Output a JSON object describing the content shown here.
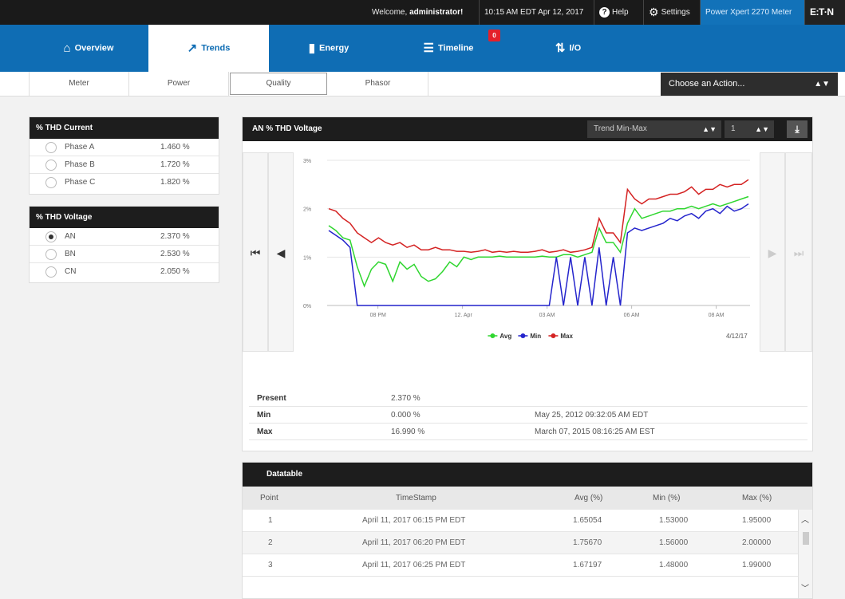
{
  "topbar": {
    "welcome_prefix": "Welcome,",
    "user": "administrator!",
    "datetime": "10:15 AM EDT Apr 12, 2017",
    "help": "Help",
    "settings": "Settings",
    "meter_name": "Power Xpert 2270 Meter",
    "brand": "E:T·N"
  },
  "nav": {
    "tabs": [
      {
        "label": "Overview",
        "icon": "home-icon"
      },
      {
        "label": "Trends",
        "icon": "trend-icon"
      },
      {
        "label": "Energy",
        "icon": "bar-chart-icon"
      },
      {
        "label": "Timeline",
        "icon": "list-icon",
        "badge": "0"
      },
      {
        "label": "I/O",
        "icon": "sort-arrows-icon"
      }
    ],
    "active": "Trends"
  },
  "subnav": {
    "tabs": [
      "Meter",
      "Power",
      "Quality",
      "Phasor"
    ],
    "active": "Quality",
    "action_label": "Choose an Action..."
  },
  "thd_current": {
    "title": "% THD Current",
    "rows": [
      {
        "label": "Phase A",
        "value": "1.460 %",
        "selected": false
      },
      {
        "label": "Phase B",
        "value": "1.720 %",
        "selected": false
      },
      {
        "label": "Phase C",
        "value": "1.820 %",
        "selected": false
      }
    ]
  },
  "thd_voltage": {
    "title": "% THD Voltage",
    "rows": [
      {
        "label": "AN",
        "value": "2.370 %",
        "selected": true
      },
      {
        "label": "BN",
        "value": "2.530 %",
        "selected": false
      },
      {
        "label": "CN",
        "value": "2.050 %",
        "selected": false
      }
    ]
  },
  "chart_panel": {
    "title": "AN % THD Voltage",
    "trend_select": "Trend Min-Max",
    "interval_select": "1",
    "date_label": "4/12/17"
  },
  "chart_data": {
    "type": "line",
    "title": "",
    "xlabel": "",
    "ylabel": "",
    "xtick_labels": [
      "08 PM",
      "12. Apr",
      "03 AM",
      "06 AM",
      "08 AM"
    ],
    "ytick_labels": [
      "0%",
      "1%",
      "2%",
      "3%"
    ],
    "ylim": [
      0,
      3
    ],
    "legend_position": "bottom",
    "series": [
      {
        "name": "Avg",
        "color": "#2fd62f",
        "values": [
          1.65,
          1.55,
          1.4,
          1.35,
          0.8,
          0.4,
          0.75,
          0.9,
          0.85,
          0.5,
          0.9,
          0.75,
          0.85,
          0.6,
          0.5,
          0.55,
          0.7,
          0.9,
          0.8,
          1.0,
          0.95,
          1.0,
          1.0,
          1.0,
          1.02,
          1.0,
          1.0,
          1.0,
          1.0,
          1.0,
          1.02,
          1.0,
          1.0,
          1.05,
          1.05,
          1.0,
          1.05,
          1.1,
          1.6,
          1.3,
          1.3,
          1.1,
          1.7,
          2.0,
          1.8,
          1.85,
          1.9,
          1.95,
          1.95,
          2.0,
          2.0,
          2.05,
          2.0,
          2.05,
          2.1,
          2.05,
          2.1,
          2.15,
          2.2,
          2.25
        ]
      },
      {
        "name": "Min",
        "color": "#2424cc",
        "values": [
          1.55,
          1.45,
          1.35,
          1.2,
          0.0,
          0.0,
          0.0,
          0.0,
          0.0,
          0.0,
          0.0,
          0.0,
          0.0,
          0.0,
          0.0,
          0.0,
          0.0,
          0.0,
          0.0,
          0.0,
          0.0,
          0.0,
          0.0,
          0.0,
          0.0,
          0.0,
          0.0,
          0.0,
          0.0,
          0.0,
          0.0,
          0.0,
          1.0,
          0.0,
          1.0,
          0.0,
          1.0,
          0.0,
          1.2,
          0.0,
          1.0,
          0.0,
          1.5,
          1.6,
          1.55,
          1.6,
          1.65,
          1.7,
          1.8,
          1.75,
          1.85,
          1.9,
          1.8,
          1.95,
          2.0,
          1.9,
          2.05,
          1.95,
          2.0,
          2.1
        ]
      },
      {
        "name": "Max",
        "color": "#d42222",
        "values": [
          2.0,
          1.95,
          1.8,
          1.7,
          1.5,
          1.4,
          1.3,
          1.4,
          1.3,
          1.25,
          1.3,
          1.2,
          1.25,
          1.15,
          1.15,
          1.2,
          1.15,
          1.15,
          1.12,
          1.12,
          1.1,
          1.12,
          1.15,
          1.1,
          1.12,
          1.1,
          1.12,
          1.1,
          1.1,
          1.12,
          1.15,
          1.1,
          1.12,
          1.15,
          1.1,
          1.12,
          1.15,
          1.2,
          1.8,
          1.5,
          1.5,
          1.3,
          2.4,
          2.2,
          2.1,
          2.2,
          2.2,
          2.25,
          2.3,
          2.3,
          2.35,
          2.45,
          2.3,
          2.4,
          2.4,
          2.5,
          2.45,
          2.5,
          2.5,
          2.6
        ]
      }
    ]
  },
  "stats": [
    {
      "label": "Present",
      "value": "2.370 %",
      "time": ""
    },
    {
      "label": "Min",
      "value": "0.000 %",
      "time": "May 25, 2012 09:32:05 AM EDT"
    },
    {
      "label": "Max",
      "value": "16.990 %",
      "time": "March 07, 2015 08:16:25 AM EST"
    }
  ],
  "datatable": {
    "title": "Datatable",
    "columns": [
      "Point",
      "TimeStamp",
      "Avg (%)",
      "Min (%)",
      "Max (%)"
    ],
    "rows": [
      [
        "1",
        "April 11, 2017 06:15 PM EDT",
        "1.65054",
        "1.53000",
        "1.95000"
      ],
      [
        "2",
        "April 11, 2017 06:20 PM EDT",
        "1.75670",
        "1.56000",
        "2.00000"
      ],
      [
        "3",
        "April 11, 2017 06:25 PM EDT",
        "1.67197",
        "1.48000",
        "1.99000"
      ]
    ]
  }
}
